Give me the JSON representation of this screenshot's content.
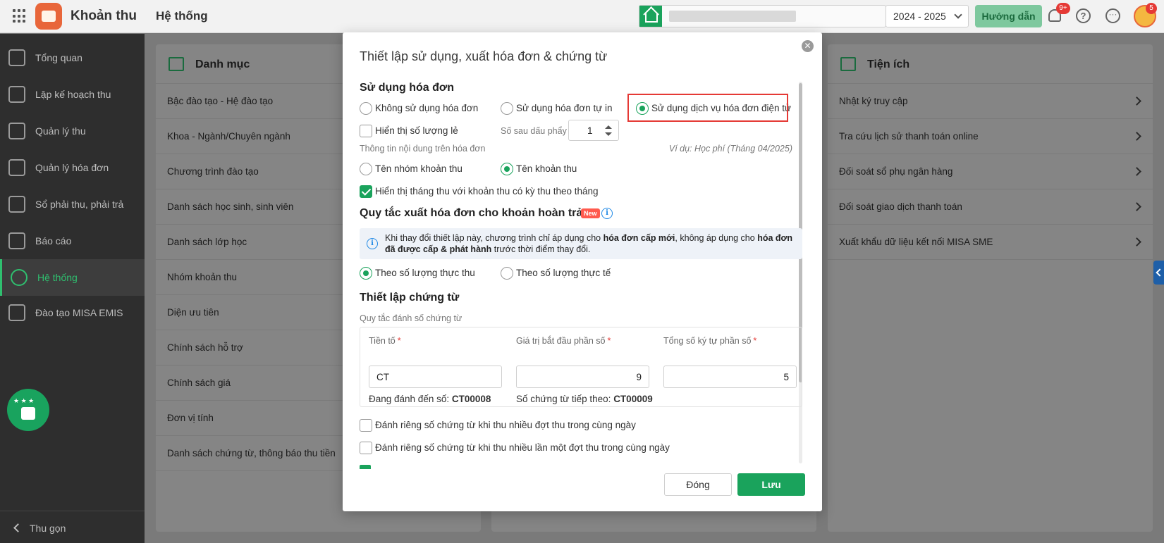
{
  "app": {
    "title": "Khoản thu",
    "module": "Hệ thống",
    "school_year": "2024 - 2025",
    "guide_label": "Hướng dẫn",
    "notification_badge": "9+",
    "avatar_badge": "5",
    "accent_color": "#1aa35c"
  },
  "sidebar": {
    "items": [
      {
        "label": "Tổng quan",
        "icon": "chart-bar-icon"
      },
      {
        "label": "Lập kế hoạch thu",
        "icon": "calendar-money-icon"
      },
      {
        "label": "Quản lý thu",
        "icon": "hand-money-icon"
      },
      {
        "label": "Quản lý hóa đơn",
        "icon": "document-icon"
      },
      {
        "label": "Sổ phải thu, phải trả",
        "icon": "ledger-icon"
      },
      {
        "label": "Báo cáo",
        "icon": "pie-chart-icon"
      },
      {
        "label": "Hệ thống",
        "icon": "gear-icon"
      },
      {
        "label": "Đào tạo MISA EMIS",
        "icon": "book-icon"
      }
    ],
    "active_index": 6,
    "collapse_label": "Thu gọn"
  },
  "catalog": {
    "title": "Danh mục",
    "items": [
      "Bậc đào tạo - Hệ đào tạo",
      "Khoa - Ngành/Chuyên ngành",
      "Chương trình đào tạo",
      "Danh sách học sinh, sinh viên",
      "Danh sách lớp học",
      "Nhóm khoản thu",
      "Diện ưu tiên",
      "Chính sách hỗ trợ",
      "Chính sách giá",
      "Đơn vị tính",
      "Danh sách chứng từ, thông báo thu tiền"
    ]
  },
  "utilities": {
    "title": "Tiện ích",
    "items": [
      "Nhật ký truy cập",
      "Tra cứu lịch sử thanh toán online",
      "Đối soát sổ phụ ngân hàng",
      "Đối soát giao dịch thanh toán",
      "Xuất khẩu dữ liệu kết nối MISA SME"
    ]
  },
  "modal": {
    "title": "Thiết lập sử dụng, xuất hóa đơn & chứng từ",
    "invoice_usage": {
      "title": "Sử dụng hóa đơn",
      "options": [
        "Không sử dụng hóa đơn",
        "Sử dụng hóa đơn tự in",
        "Sử dụng dịch vụ hóa đơn điện tử"
      ],
      "selected": 2,
      "show_decimal_qty_label": "Hiển thị số lượng lẻ",
      "show_decimal_qty_checked": false,
      "decimal_places_label": "Số sau dấu phẩy",
      "decimal_places_value": "1",
      "content_info_label": "Thông tin nội dung trên hóa đơn",
      "example_text": "Ví dụ: Học phí (Tháng 04/2025)",
      "name_options": [
        "Tên nhóm khoản thu",
        "Tên khoản thu"
      ],
      "name_selected": 1,
      "show_month_label": "Hiển thị tháng thu với khoản thu có kỳ thu theo tháng",
      "show_month_checked": true
    },
    "refund_rule": {
      "title": "Quy tắc xuất hóa đơn cho khoản hoàn trả",
      "new_badge": "New",
      "info_part1": "Khi thay đổi thiết lập này, chương trình chỉ áp dụng cho ",
      "info_bold1": "hóa đơn cấp mới",
      "info_part2": ", không áp dụng cho ",
      "info_bold2": "hóa đơn đã được cấp & phát hành",
      "info_part3": " trước thời điểm thay đổi.",
      "options": [
        "Theo số lượng thực thu",
        "Theo số lượng thực tế"
      ],
      "selected": 0
    },
    "voucher": {
      "title": "Thiết lập chứng từ",
      "numbering_label": "Quy tắc đánh số chứng từ",
      "prefix_label": "Tiền tố",
      "prefix_value": "CT",
      "start_label": "Giá trị bắt đầu phần số",
      "start_value": "9",
      "digits_label": "Tổng số ký tự phần số",
      "digits_value": "5",
      "current_label": "Đang đánh đến số:",
      "current_value": "CT00008",
      "next_label": "Số chứng từ tiếp theo:",
      "next_value": "CT00009",
      "separate_same_day_label": "Đánh riêng số chứng từ khi thu nhiều đợt thu trong cùng ngày",
      "separate_same_batch_label": "Đánh riêng số chứng từ khi thu nhiều lần một đợt thu trong cùng ngày"
    },
    "close_label": "Đóng",
    "save_label": "Lưu"
  }
}
